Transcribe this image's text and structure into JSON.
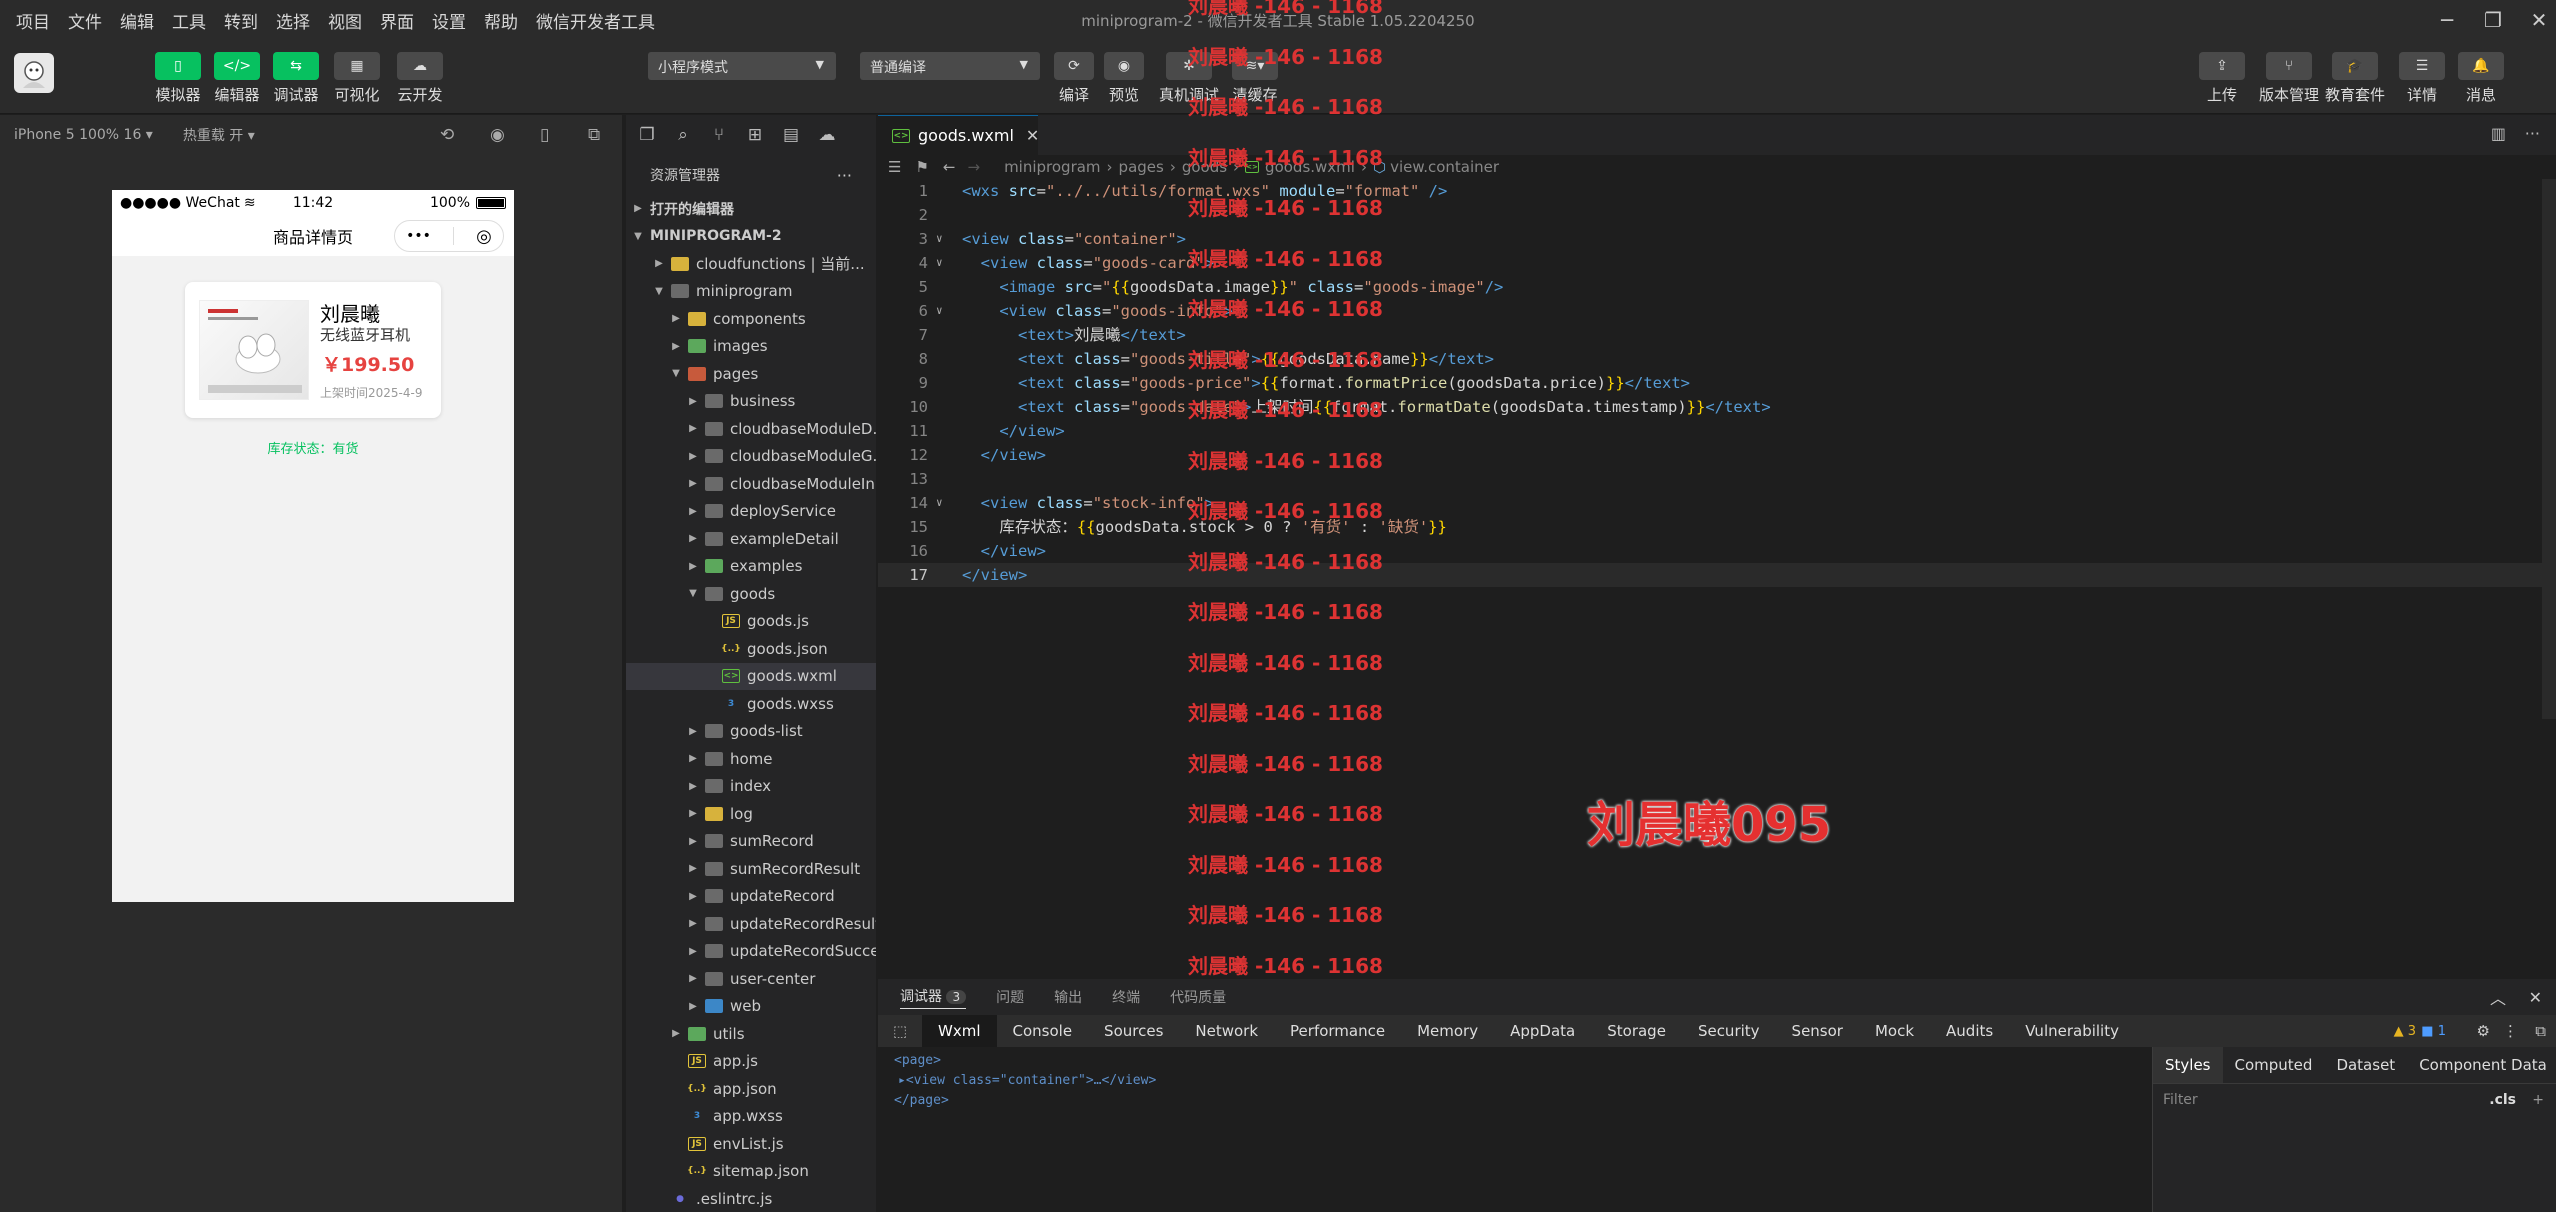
{
  "menubar": {
    "items": [
      "项目",
      "文件",
      "编辑",
      "工具",
      "转到",
      "选择",
      "视图",
      "界面",
      "设置",
      "帮助",
      "微信开发者工具"
    ],
    "window_title": "miniprogram-2 - 微信开发者工具 Stable 1.05.2204250"
  },
  "toolbar": {
    "simulator": "模拟器",
    "editor": "编辑器",
    "debugger": "调试器",
    "visual": "可视化",
    "cloud": "云开发",
    "mode_select": "小程序模式",
    "compile_select": "普通编译",
    "compile": "编译",
    "preview": "预览",
    "real_debug": "真机调试",
    "clear_cache": "清缓存",
    "upload": "上传",
    "version": "版本管理",
    "education": "教育套件",
    "details": "详情",
    "messages": "消息"
  },
  "sim_bar": {
    "device": "iPhone 5 100% 16",
    "hot_reload": "热重载 开"
  },
  "phone": {
    "carrier": "●●●●● WeChat",
    "time": "11:42",
    "battery": "100%",
    "nav_title": "商品详情页",
    "capsule_more": "•••",
    "goods_title": "刘晨曦",
    "goods_name": "无线蓝牙耳机",
    "goods_price": "￥199.50",
    "goods_date": "上架时间2025-4-9",
    "stock": "库存状态：有货"
  },
  "explorer": {
    "title": "资源管理器",
    "open_editors": "打开的编辑器",
    "project": "MINIPROGRAM-2",
    "rows": [
      {
        "label": "cloudfunctions | 当前...",
        "depth": 1,
        "tw": "▶",
        "icon": "folder-y",
        "icon_text": "",
        "cls": "",
        "name": "tree-folder-cloudfunctions"
      },
      {
        "label": "miniprogram",
        "depth": 1,
        "tw": "▼",
        "icon": "folder",
        "icon_text": "",
        "cls": "",
        "name": "tree-folder-miniprogram"
      },
      {
        "label": "components",
        "depth": 2,
        "tw": "▶",
        "icon": "folder-y",
        "icon_text": "",
        "cls": "",
        "name": "tree-folder-components"
      },
      {
        "label": "images",
        "depth": 2,
        "tw": "▶",
        "icon": "folder-g",
        "icon_text": "",
        "cls": "",
        "name": "tree-folder-images"
      },
      {
        "label": "pages",
        "depth": 2,
        "tw": "▼",
        "icon": "folder-r",
        "icon_text": "",
        "cls": "",
        "name": "tree-folder-pages"
      },
      {
        "label": "business",
        "depth": 3,
        "tw": "▶",
        "icon": "folder",
        "icon_text": "",
        "cls": "",
        "name": "tree-folder-business"
      },
      {
        "label": "cloudbaseModuleD...",
        "depth": 3,
        "tw": "▶",
        "icon": "folder",
        "icon_text": "",
        "cls": "",
        "name": "tree-folder-cloudbase-d"
      },
      {
        "label": "cloudbaseModuleG...",
        "depth": 3,
        "tw": "▶",
        "icon": "folder",
        "icon_text": "",
        "cls": "",
        "name": "tree-folder-cloudbase-g"
      },
      {
        "label": "cloudbaseModuleIn...",
        "depth": 3,
        "tw": "▶",
        "icon": "folder",
        "icon_text": "",
        "cls": "",
        "name": "tree-folder-cloudbase-in"
      },
      {
        "label": "deployService",
        "depth": 3,
        "tw": "▶",
        "icon": "folder",
        "icon_text": "",
        "cls": "",
        "name": "tree-folder-deployservice"
      },
      {
        "label": "exampleDetail",
        "depth": 3,
        "tw": "▶",
        "icon": "folder",
        "icon_text": "",
        "cls": "",
        "name": "tree-folder-exampledetail"
      },
      {
        "label": "examples",
        "depth": 3,
        "tw": "▶",
        "icon": "folder-g",
        "icon_text": "",
        "cls": "",
        "name": "tree-folder-examples"
      },
      {
        "label": "goods",
        "depth": 3,
        "tw": "▼",
        "icon": "folder",
        "icon_text": "",
        "cls": "",
        "name": "tree-folder-goods"
      },
      {
        "label": "goods.js",
        "depth": 4,
        "tw": "",
        "icon": "js",
        "icon_text": "JS",
        "cls": "",
        "name": "tree-file-goods-js"
      },
      {
        "label": "goods.json",
        "depth": 4,
        "tw": "",
        "icon": "json",
        "icon_text": "{..}",
        "cls": "",
        "name": "tree-file-goods-json"
      },
      {
        "label": "goods.wxml",
        "depth": 4,
        "tw": "",
        "icon": "wxml",
        "icon_text": "&lt;&gt;",
        "cls": "sel",
        "name": "tree-file-goods-wxml"
      },
      {
        "label": "goods.wxss",
        "depth": 4,
        "tw": "",
        "icon": "wxss",
        "icon_text": "3",
        "cls": "",
        "name": "tree-file-goods-wxss"
      },
      {
        "label": "goods-list",
        "depth": 3,
        "tw": "▶",
        "icon": "folder",
        "icon_text": "",
        "cls": "",
        "name": "tree-folder-goods-list"
      },
      {
        "label": "home",
        "depth": 3,
        "tw": "▶",
        "icon": "folder",
        "icon_text": "",
        "cls": "",
        "name": "tree-folder-home"
      },
      {
        "label": "index",
        "depth": 3,
        "tw": "▶",
        "icon": "folder",
        "icon_text": "",
        "cls": "",
        "name": "tree-folder-index"
      },
      {
        "label": "log",
        "depth": 3,
        "tw": "▶",
        "icon": "folder-y",
        "icon_text": "",
        "cls": "",
        "name": "tree-folder-log"
      },
      {
        "label": "sumRecord",
        "depth": 3,
        "tw": "▶",
        "icon": "folder",
        "icon_text": "",
        "cls": "",
        "name": "tree-folder-sumrecord"
      },
      {
        "label": "sumRecordResult",
        "depth": 3,
        "tw": "▶",
        "icon": "folder",
        "icon_text": "",
        "cls": "",
        "name": "tree-folder-sumrecordresult"
      },
      {
        "label": "updateRecord",
        "depth": 3,
        "tw": "▶",
        "icon": "folder",
        "icon_text": "",
        "cls": "",
        "name": "tree-folder-updaterecord"
      },
      {
        "label": "updateRecordResult",
        "depth": 3,
        "tw": "▶",
        "icon": "folder",
        "icon_text": "",
        "cls": "",
        "name": "tree-folder-updaterecordresult"
      },
      {
        "label": "updateRecordSuccess",
        "depth": 3,
        "tw": "▶",
        "icon": "folder",
        "icon_text": "",
        "cls": "",
        "name": "tree-folder-updaterecordsuccess"
      },
      {
        "label": "user-center",
        "depth": 3,
        "tw": "▶",
        "icon": "folder",
        "icon_text": "",
        "cls": "",
        "name": "tree-folder-user-center"
      },
      {
        "label": "web",
        "depth": 3,
        "tw": "▶",
        "icon": "folder-b",
        "icon_text": "",
        "cls": "",
        "name": "tree-folder-web"
      },
      {
        "label": "utils",
        "depth": 2,
        "tw": "▶",
        "icon": "folder-g",
        "icon_text": "",
        "cls": "",
        "name": "tree-folder-utils"
      },
      {
        "label": "app.js",
        "depth": 2,
        "tw": "",
        "icon": "js",
        "icon_text": "JS",
        "cls": "",
        "name": "tree-file-app-js"
      },
      {
        "label": "app.json",
        "depth": 2,
        "tw": "",
        "icon": "json",
        "icon_text": "{..}",
        "cls": "",
        "name": "tree-file-app-json"
      },
      {
        "label": "app.wxss",
        "depth": 2,
        "tw": "",
        "icon": "wxss",
        "icon_text": "3",
        "cls": "",
        "name": "tree-file-app-wxss"
      },
      {
        "label": "envList.js",
        "depth": 2,
        "tw": "",
        "icon": "js",
        "icon_text": "JS",
        "cls": "",
        "name": "tree-file-envlist-js"
      },
      {
        "label": "sitemap.json",
        "depth": 2,
        "tw": "",
        "icon": "json",
        "icon_text": "{..}",
        "cls": "",
        "name": "tree-file-sitemap-json"
      },
      {
        "label": ".eslintrc.js",
        "depth": 1,
        "tw": "",
        "icon": "dot",
        "icon_text": "●",
        "cls": "",
        "name": "tree-file-eslintrc"
      }
    ]
  },
  "editor": {
    "tab": "goods.wxml",
    "breadcrumb": [
      "miniprogram",
      "pages",
      "goods",
      "goods.wxml",
      "view.container"
    ],
    "lines": [
      [
        [
          "tg",
          "<wxs "
        ],
        [
          "at",
          "src"
        ],
        [
          "pu",
          "="
        ],
        [
          "sv",
          "\"../../utils/format.wxs\""
        ],
        [
          "at",
          " module"
        ],
        [
          "pu",
          "="
        ],
        [
          "sv",
          "\"format\""
        ],
        [
          "tg",
          " />"
        ]
      ],
      [],
      [
        [
          "tg",
          "<view "
        ],
        [
          "at",
          "class"
        ],
        [
          "pu",
          "="
        ],
        [
          "sv",
          "\"container\""
        ],
        [
          "tg",
          ">"
        ]
      ],
      [
        [
          "tx",
          "  "
        ],
        [
          "tg",
          "<view "
        ],
        [
          "at",
          "class"
        ],
        [
          "pu",
          "="
        ],
        [
          "sv",
          "\"goods-card\""
        ],
        [
          "tg",
          ">"
        ]
      ],
      [
        [
          "tx",
          "    "
        ],
        [
          "tg",
          "<image "
        ],
        [
          "at",
          "src"
        ],
        [
          "pu",
          "="
        ],
        [
          "sv",
          "\""
        ],
        [
          "br",
          "{{"
        ],
        [
          "tx",
          "goodsData.image"
        ],
        [
          "br",
          "}}"
        ],
        [
          "sv",
          "\""
        ],
        [
          "at",
          " class"
        ],
        [
          "pu",
          "="
        ],
        [
          "sv",
          "\"goods-image\""
        ],
        [
          "tg",
          "/>"
        ]
      ],
      [
        [
          "tx",
          "    "
        ],
        [
          "tg",
          "<view "
        ],
        [
          "at",
          "class"
        ],
        [
          "pu",
          "="
        ],
        [
          "sv",
          "\"goods-info\""
        ],
        [
          "tg",
          ">"
        ]
      ],
      [
        [
          "tx",
          "      "
        ],
        [
          "tg",
          "<text>"
        ],
        [
          "tx",
          "刘晨曦"
        ],
        [
          "tg",
          "</text>"
        ]
      ],
      [
        [
          "tx",
          "      "
        ],
        [
          "tg",
          "<text "
        ],
        [
          "at",
          "class"
        ],
        [
          "pu",
          "="
        ],
        [
          "sv",
          "\"goods-title\""
        ],
        [
          "tg",
          ">"
        ],
        [
          "br",
          "{{"
        ],
        [
          "tx",
          "goodsData.name"
        ],
        [
          "br",
          "}}"
        ],
        [
          "tg",
          "</text>"
        ]
      ],
      [
        [
          "tx",
          "      "
        ],
        [
          "tg",
          "<text "
        ],
        [
          "at",
          "class"
        ],
        [
          "pu",
          "="
        ],
        [
          "sv",
          "\"goods-price\""
        ],
        [
          "tg",
          ">"
        ],
        [
          "br",
          "{{"
        ],
        [
          "tx",
          "format."
        ],
        [
          "fn",
          "formatPrice"
        ],
        [
          "tx",
          "(goodsData.price)"
        ],
        [
          "br",
          "}}"
        ],
        [
          "tg",
          "</text>"
        ]
      ],
      [
        [
          "tx",
          "      "
        ],
        [
          "tg",
          "<text "
        ],
        [
          "at",
          "class"
        ],
        [
          "pu",
          "="
        ],
        [
          "sv",
          "\"goods-date\""
        ],
        [
          "tg",
          ">"
        ],
        [
          "tx",
          "上架时间"
        ],
        [
          "br",
          "{{"
        ],
        [
          "tx",
          "format."
        ],
        [
          "fn",
          "formatDate"
        ],
        [
          "tx",
          "(goodsData.timestamp)"
        ],
        [
          "br",
          "}}"
        ],
        [
          "tg",
          "</text>"
        ]
      ],
      [
        [
          "tx",
          "    "
        ],
        [
          "tg",
          "</view>"
        ]
      ],
      [
        [
          "tx",
          "  "
        ],
        [
          "tg",
          "</view>"
        ]
      ],
      [],
      [
        [
          "tx",
          "  "
        ],
        [
          "tg",
          "<view "
        ],
        [
          "at",
          "class"
        ],
        [
          "pu",
          "="
        ],
        [
          "sv",
          "\"stock-info\""
        ],
        [
          "tg",
          ">"
        ]
      ],
      [
        [
          "tx",
          "    库存状态："
        ],
        [
          "br",
          "{{"
        ],
        [
          "tx",
          "goodsData.stock > 0 ? "
        ],
        [
          "sv",
          "'有货'"
        ],
        [
          "tx",
          " : "
        ],
        [
          "sv",
          "'缺货'"
        ],
        [
          "br",
          "}}"
        ]
      ],
      [
        [
          "tx",
          "  "
        ],
        [
          "tg",
          "</view>"
        ]
      ],
      [
        [
          "tg",
          "</view>"
        ]
      ]
    ]
  },
  "watermark": {
    "text": "刘晨曦 -146 - 1168",
    "big": "刘晨曦095"
  },
  "panel": {
    "debugger": "调试器",
    "debugger_count": "3",
    "issues": "问题",
    "output": "输出",
    "terminal": "终端",
    "code_quality": "代码质量"
  },
  "devtools": {
    "tabs": [
      "Wxml",
      "Console",
      "Sources",
      "Network",
      "Performance",
      "Memory",
      "AppData",
      "Storage",
      "Security",
      "Sensor",
      "Mock",
      "Audits",
      "Vulnerability"
    ],
    "warn_count": "3",
    "info_count": "1",
    "tree": [
      "<page>",
      "<view class=\"container\">…</view>",
      "</page>"
    ]
  },
  "styles": {
    "tabs": [
      "Styles",
      "Computed",
      "Dataset",
      "Component Data"
    ],
    "filter": "Filter",
    "cls": ".cls"
  }
}
